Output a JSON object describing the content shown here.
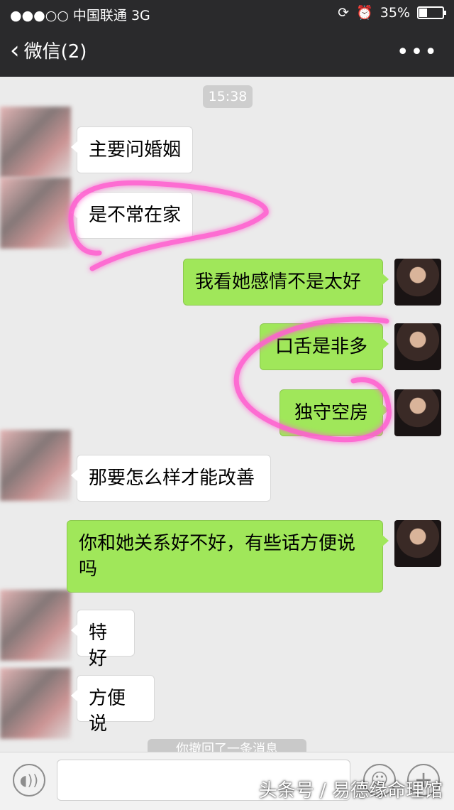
{
  "status_bar": {
    "carrier": "●●●○○ 中国联通   3G",
    "battery": "35%",
    "battery_level": 0.35
  },
  "nav": {
    "back_label": "微信(2)",
    "more_icon": "more-dots-icon"
  },
  "chat": {
    "timestamp": "15:38",
    "messages": [
      {
        "from": "other",
        "text": "主要问婚姻"
      },
      {
        "from": "other",
        "text": "是不常在家"
      },
      {
        "from": "me",
        "text": "我看她感情不是太好"
      },
      {
        "from": "me",
        "text": "口舌是非多"
      },
      {
        "from": "me",
        "text": "独守空房"
      },
      {
        "from": "other",
        "text": "那要怎么样才能改善"
      },
      {
        "from": "me",
        "text": "你和她关系好不好，有些话方便说吗"
      },
      {
        "from": "other",
        "text": "特好"
      },
      {
        "from": "other",
        "text": "方便说"
      }
    ],
    "partial_notice": "你撤回了一条消息"
  },
  "input_bar": {
    "voice_icon": "voice-icon",
    "emoji_icon": "emoji-icon",
    "plus_icon": "plus-icon"
  },
  "watermark": "头条号 / 易德缘命理馆",
  "colors": {
    "header_bg": "#2a2a2c",
    "bubble_out": "#a0e75a",
    "bubble_in": "#ffffff",
    "highlight": "#ff4fc8"
  }
}
